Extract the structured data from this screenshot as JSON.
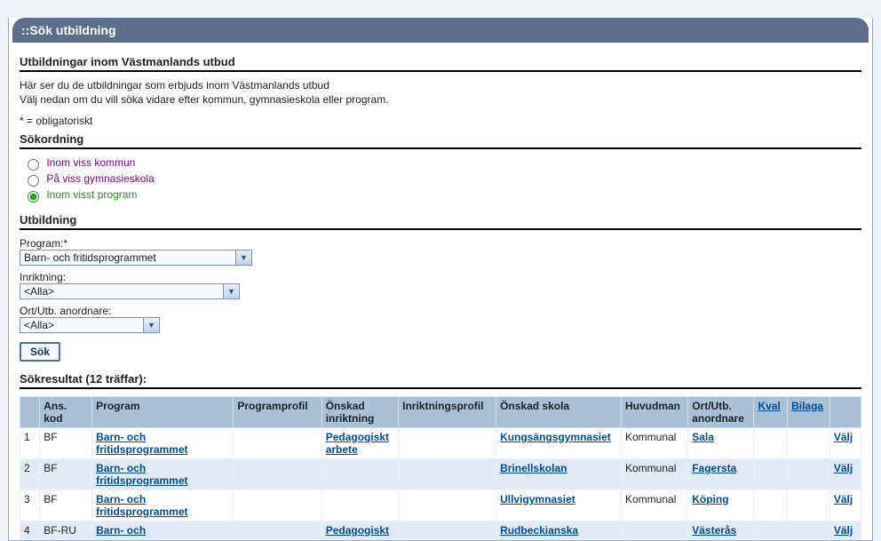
{
  "title_bar": "::Sök utbildning",
  "intro": {
    "heading": "Utbildningar inom Västmanlands utbud",
    "line1": "Här ser du de utbildningar som erbjuds inom Västmanlands utbud",
    "line2": "Välj nedan om du vill söka vidare efter kommun, gymnasieskola eller program.",
    "mandatory": "* = obligatoriskt"
  },
  "sokordning": {
    "heading": "Sökordning",
    "options": [
      {
        "label": "Inom viss kommun",
        "checked": false
      },
      {
        "label": "På viss gymnasieskola",
        "checked": false
      },
      {
        "label": "Inom visst program",
        "checked": true
      }
    ]
  },
  "utbildning": {
    "heading": "Utbildning",
    "program_label": "Program:*",
    "program_value": "Barn- och fritidsprogrammet",
    "inriktning_label": "Inriktning:",
    "inriktning_value": "<Alla>",
    "ort_label": "Ort/Utb. anordnare:",
    "ort_value": "<Alla>",
    "search_button": "Sök"
  },
  "results_heading": "Sökresultat (12 träffar):",
  "columns": {
    "idx": "",
    "anskod": "Ans. kod",
    "program": "Program",
    "profil": "Programprofil",
    "onskad_inriktning": "Önskad inriktning",
    "inriktningsprofil": "Inriktningsprofil",
    "onskad_skola": "Önskad skola",
    "huvudman": "Huvudman",
    "ort": "Ort/Utb. anordnare",
    "kval": "Kval",
    "bilaga": "Bilaga",
    "valj": ""
  },
  "rows": [
    {
      "idx": "1",
      "anskod": "BF",
      "program": "Barn- och fritidsprogrammet",
      "profil": "",
      "onskad_inriktning": "Pedagogiskt arbete",
      "inriktningsprofil": "",
      "onskad_skola": "Kungsängsgymnasiet",
      "huvudman": "Kommunal",
      "ort": "Sala",
      "kval": "",
      "bilaga": "",
      "valj": "Välj"
    },
    {
      "idx": "2",
      "anskod": "BF",
      "program": "Barn- och fritidsprogrammet",
      "profil": "",
      "onskad_inriktning": "",
      "inriktningsprofil": "",
      "onskad_skola": "Brinellskolan",
      "huvudman": "Kommunal",
      "ort": "Fagersta",
      "kval": "",
      "bilaga": "",
      "valj": "Välj"
    },
    {
      "idx": "3",
      "anskod": "BF",
      "program": "Barn- och fritidsprogrammet",
      "profil": "",
      "onskad_inriktning": "",
      "inriktningsprofil": "",
      "onskad_skola": "Ullvigymnasiet",
      "huvudman": "Kommunal",
      "ort": "Köping",
      "kval": "",
      "bilaga": "",
      "valj": "Välj"
    },
    {
      "idx": "4",
      "anskod": "BF-RU",
      "program": "Barn- och",
      "profil": "",
      "onskad_inriktning": "Pedagogiskt",
      "inriktningsprofil": "",
      "onskad_skola": "Rudbeckianska",
      "huvudman": "",
      "ort": "Västerås",
      "kval": "",
      "bilaga": "",
      "valj": "Välj"
    }
  ]
}
